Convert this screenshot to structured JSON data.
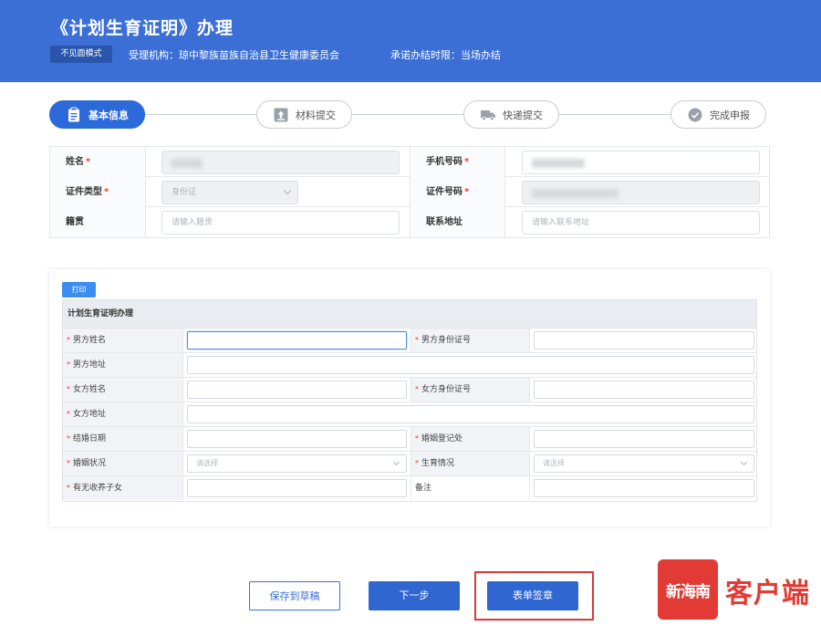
{
  "header": {
    "title": "《计划生育证明》办理",
    "mode_button": "不见面模式",
    "agency": "受理机构：琼中黎族苗族自治县卫生健康委员会",
    "deadline": "承诺办结时限：当场办结"
  },
  "steps": [
    {
      "label": "基本信息",
      "icon": "clipboard-icon",
      "active": true
    },
    {
      "label": "材料提交",
      "icon": "upload-icon",
      "active": false
    },
    {
      "label": "快递提交",
      "icon": "truck-icon",
      "active": false
    },
    {
      "label": "完成申报",
      "icon": "check-circle-icon",
      "active": false
    }
  ],
  "basic_info": {
    "name_label": "姓名",
    "phone_label": "手机号码",
    "id_type_label": "证件类型",
    "id_type_value": "身份证",
    "id_number_label": "证件号码",
    "native_place_label": "籍贯",
    "native_place_placeholder": "请输入籍贯",
    "address_label": "联系地址",
    "address_placeholder": "请输入联系地址"
  },
  "form": {
    "print_button": "打印",
    "title": "计划生育证明办理",
    "fields": {
      "husband_name": "男方姓名",
      "husband_id": "男方身份证号",
      "husband_address": "男方地址",
      "wife_name": "女方姓名",
      "wife_id": "女方身份证号",
      "wife_address": "女方地址",
      "marriage_date": "结婚日期",
      "marriage_office": "婚姻登记处",
      "marital_status": "婚姻状况",
      "marital_status_placeholder": "请选择",
      "birth_status": "生育情况",
      "birth_status_placeholder": "请选择",
      "adopted_children": "有无收养子女",
      "remarks": "备注"
    }
  },
  "buttons": {
    "save_draft": "保存到草稿",
    "next": "下一步",
    "sign": "表单签章"
  },
  "watermark": {
    "logo_text": "新海南",
    "text": "客户端"
  },
  "colors": {
    "header_bg": "#3b6fd6",
    "primary": "#2f66d0",
    "required": "#e0463d",
    "highlight": "#d93a3a",
    "watermark": "#e23a34"
  }
}
